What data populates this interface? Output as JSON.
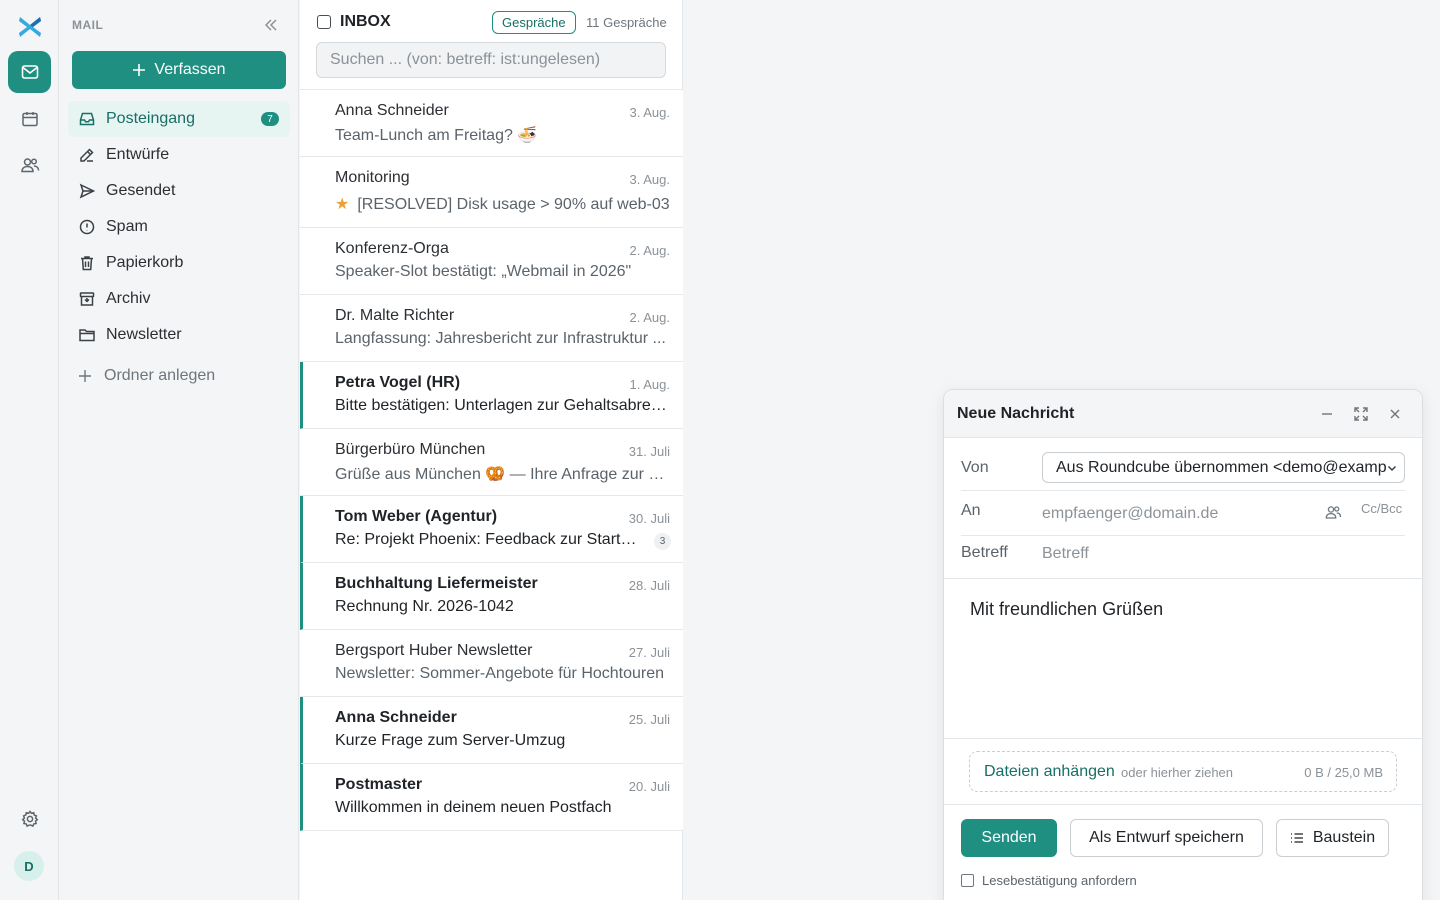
{
  "colors": {
    "accent": "#1f8f82",
    "accent_dark": "#176f66",
    "accent_light": "#e6f4f2",
    "star": "#e9a23b",
    "logo_blue": "#37a8e0"
  },
  "rail": {
    "icons": [
      "mail-icon",
      "calendar-icon",
      "contacts-icon",
      "settings-icon"
    ],
    "avatar_initial": "D"
  },
  "sidebar": {
    "section_title": "MAIL",
    "compose_label": "Verfassen",
    "add_folder_label": "Ordner anlegen",
    "folders": [
      {
        "label": "Posteingang",
        "icon": "inbox-icon",
        "count": "7"
      },
      {
        "label": "Entwürfe",
        "icon": "pencil-icon"
      },
      {
        "label": "Gesendet",
        "icon": "send-icon"
      },
      {
        "label": "Spam",
        "icon": "alert-circle-icon"
      },
      {
        "label": "Papierkorb",
        "icon": "trash-icon"
      },
      {
        "label": "Archiv",
        "icon": "archive-icon"
      },
      {
        "label": "Newsletter",
        "icon": "folder-icon"
      }
    ]
  },
  "list": {
    "folder_name": "INBOX",
    "threads_label": "Gespräche",
    "count_label": "11 Gespräche",
    "search_placeholder": "Suchen ... (von: betreff: ist:ungelesen)",
    "messages": [
      {
        "sender": "Anna Schneider",
        "date": "3. Aug.",
        "subject": "Team-Lunch am Freitag? 🍜",
        "unread": false
      },
      {
        "sender": "Monitoring",
        "date": "3. Aug.",
        "subject": "[RESOLVED] Disk usage > 90% auf web-03",
        "unread": false,
        "starred": true
      },
      {
        "sender": "Konferenz-Orga",
        "date": "2. Aug.",
        "subject": "Speaker-Slot bestätigt: „Webmail in 2026\"",
        "unread": false
      },
      {
        "sender": "Dr. Malte Richter",
        "date": "2. Aug.",
        "subject": "Langfassung: Jahresbericht zur Infrastruktur ...",
        "unread": false
      },
      {
        "sender": "Petra Vogel (HR)",
        "date": "1. Aug.",
        "subject": "Bitte bestätigen: Unterlagen zur Gehaltsabrec...",
        "unread": true
      },
      {
        "sender": "Bürgerbüro München",
        "date": "31. Juli",
        "subject": "Grüße aus München 🥨 — Ihre Anfrage zur U...",
        "unread": false
      },
      {
        "sender": "Tom Weber (Agentur)",
        "date": "30. Juli",
        "subject": "Re: Projekt Phoenix: Feedback zur Startse...",
        "unread": true,
        "thread_count": "3"
      },
      {
        "sender": "Buchhaltung Liefermeister",
        "date": "28. Juli",
        "subject": "Rechnung Nr. 2026-1042",
        "unread": true
      },
      {
        "sender": "Bergsport Huber Newsletter",
        "date": "27. Juli",
        "subject": "Newsletter: Sommer-Angebote für Hochtouren",
        "unread": false
      },
      {
        "sender": "Anna Schneider",
        "date": "25. Juli",
        "subject": "Kurze Frage zum Server-Umzug",
        "unread": true
      },
      {
        "sender": "Postmaster",
        "date": "20. Juli",
        "subject": "Willkommen in deinem neuen Postfach",
        "unread": true
      }
    ]
  },
  "compose": {
    "title": "Neue Nachricht",
    "from_label": "Von",
    "from_value": "Aus Roundcube übernommen <demo@examp",
    "to_label": "An",
    "to_placeholder": "empfaenger@domain.de",
    "ccbcc_label": "Cc/Bcc",
    "subject_label": "Betreff",
    "subject_placeholder": "Betreff",
    "body": "Mit freundlichen Grüßen",
    "attach_label": "Dateien anhängen",
    "attach_hint": "oder hierher ziehen",
    "attach_size": "0 B / 25,0 MB",
    "send_label": "Senden",
    "draft_label": "Als Entwurf speichern",
    "snippet_label": "Baustein",
    "receipt_label": "Lesebestätigung anfordern"
  }
}
